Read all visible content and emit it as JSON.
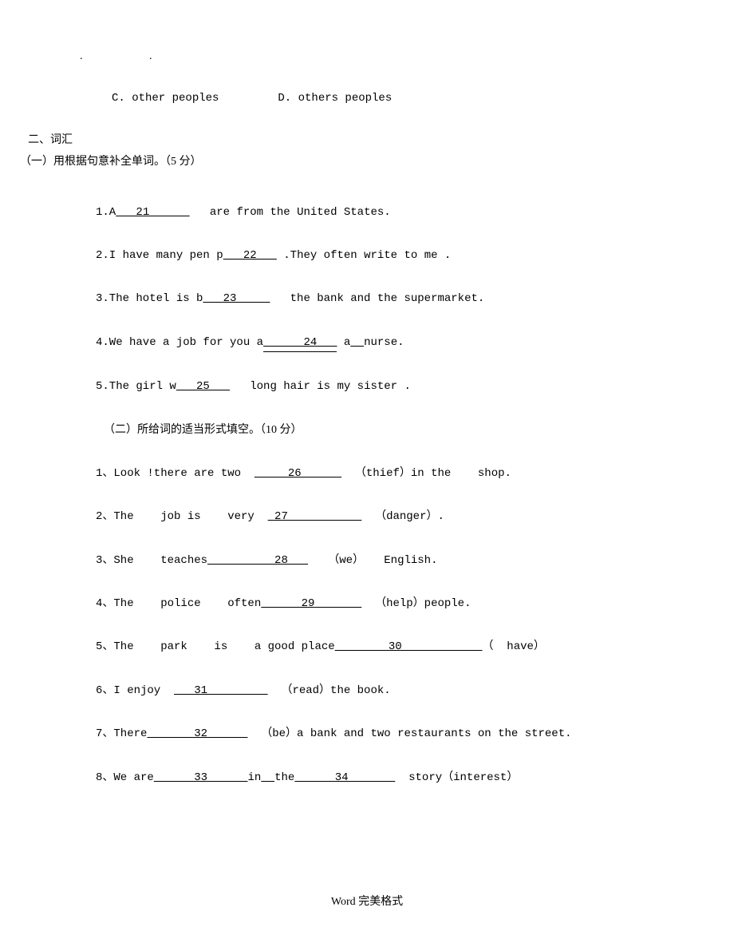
{
  "dots": ". .",
  "options": {
    "c_label": "C. other peoples",
    "d_label": "D. others peoples"
  },
  "section2": {
    "header": "二、词汇",
    "sub1_header": "（一）用根据句意补全单词。（5 分）",
    "q1_pre": "1.A",
    "q1_blank": "   21      ",
    "q1_post": "   are from the United States.",
    "q2_pre": "2.I have many pen p",
    "q2_blank": "   22   ",
    "q2_post": " .They often write to me .",
    "q3_pre": "3.The hotel is b",
    "q3_blank": "   23     ",
    "q3_post": "   the bank and the supermarket.",
    "q4_pre": "4.We have a job for you a",
    "q4_blank": "      24   ",
    "q4_post": " a",
    "q4_blank2": "  ",
    "q4_post2": "nurse.",
    "q5_pre": "5.The girl w",
    "q5_blank": "   25   ",
    "q5_post": "   long hair is my sister .",
    "sub2_header": "（二）所给词的适当形式填空。（10 分）",
    "p1_pre": "1、Look !there are two  ",
    "p1_blank": "     26      ",
    "p1_post": "  （thief）in the    shop.",
    "p2_pre": "2、The    job is    very  ",
    "p2_blank": " 27           ",
    "p2_post": "  （danger）.",
    "p3_pre": "3、She    teaches",
    "p3_blank": "          28   ",
    "p3_post": "   （we）   English.",
    "p4_pre": "4、The    police    often",
    "p4_blank": "      29       ",
    "p4_post": "  （help）people.",
    "p5_pre": "5、The    park    is    a good place",
    "p5_blank": "        30            ",
    "p5_post": "（  have）",
    "p6_pre": "6、I enjoy  ",
    "p6_blank": "   31         ",
    "p6_post": "  （read）the book.",
    "p7_pre": "7、There",
    "p7_blank": "       32      ",
    "p7_post": "  （be）a bank and two restaurants on the street.",
    "p8_pre": "8、We are",
    "p8_blank": "      33      ",
    "p8_mid": "in",
    "p8_blank2": "  ",
    "p8_mid2": "the",
    "p8_blank3": "      34       ",
    "p8_post": "  story（interest）"
  },
  "footer": "Word 完美格式"
}
